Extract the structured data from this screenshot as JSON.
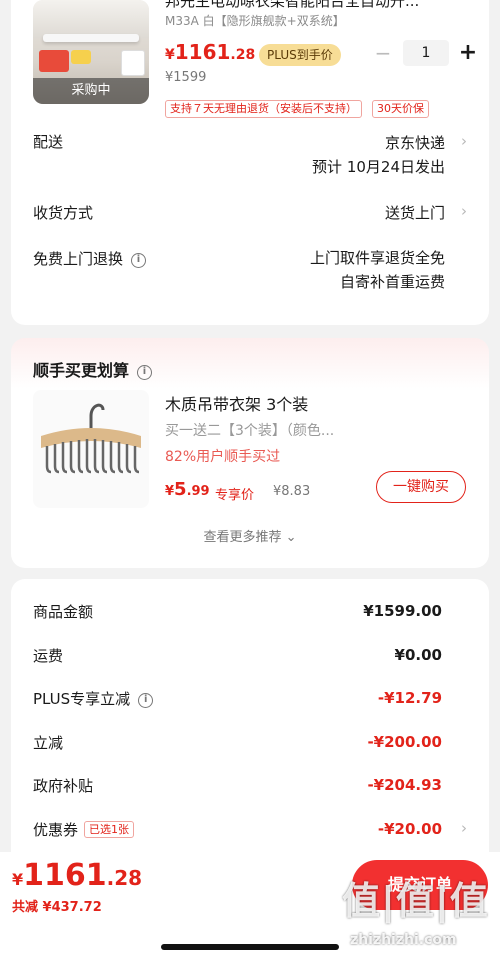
{
  "product": {
    "title": "邦先生电动晾衣架智能阳台全自动升...",
    "spec": "M33A 白【隐形旗舰款+双系统】",
    "thumb_badge": "采购中",
    "price": {
      "currency": "¥",
      "int": "1161",
      "dec": ".28"
    },
    "plus_tag": "PLUS到手价",
    "original_price": "¥1599",
    "quantity": "1",
    "tags": [
      "支持７天无理由退货（安装后不支持）",
      "30天价保"
    ]
  },
  "delivery": {
    "label": "配送",
    "carrier": "京东快递",
    "eta": "预计 10月24日发出"
  },
  "receive": {
    "label": "收货方式",
    "value": "送货上门"
  },
  "return_svc": {
    "label": "免费上门退换",
    "line1": "上门取件享退货全免",
    "line2": "自寄补首重运费"
  },
  "recommend": {
    "title": "顺手买更划算",
    "item_name": "木质吊带衣架 3个装",
    "item_desc": "买一送二【3个装】（颜色...",
    "item_pct": "82%用户顺手买过",
    "price": {
      "currency": "¥",
      "int": "5",
      "dec": ".99"
    },
    "exclusive": "专享价",
    "orig_price": "¥8.83",
    "buy_label": "一键购买",
    "more_label": "查看更多推荐 ⌄"
  },
  "summary": {
    "goods_label": "商品金额",
    "goods_value": "¥1599.00",
    "ship_label": "运费",
    "ship_value": "¥0.00",
    "plus_label": "PLUS专享立减",
    "plus_value": "-¥12.79",
    "instant_label": "立减",
    "instant_value": "-¥200.00",
    "gov_label": "政府补贴",
    "gov_value": "-¥204.93",
    "coupon_label": "优惠券",
    "coupon_tag": "已选1张",
    "coupon_value": "-¥20.00"
  },
  "footer": {
    "total": {
      "currency": "¥",
      "int": "1161",
      "dec": ".28"
    },
    "saved": "共减 ¥437.72",
    "submit_label": "提交订单"
  },
  "watermark": {
    "brand": "值|值|值",
    "url": "zhizhizhi.com"
  },
  "colors": {
    "accent_red": "#e2231a",
    "button_red": "#f23030",
    "plus_gold": "#f7dd96"
  }
}
